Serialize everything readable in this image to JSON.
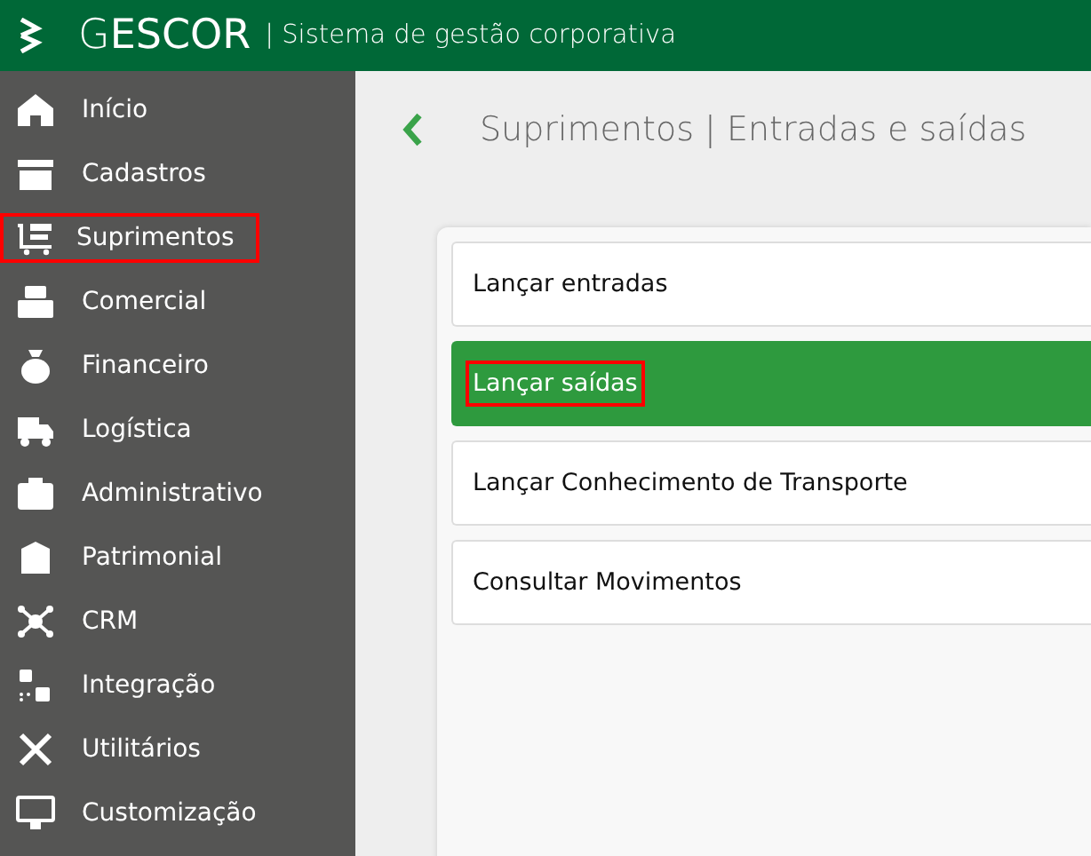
{
  "header": {
    "logo": "G**ESCOR**",
    "subtitle": "| Sistema de gestão corporativa"
  },
  "sidebar": {
    "items": [
      {
        "label": "Início",
        "highlighted": false
      },
      {
        "label": "Cadastros",
        "highlighted": false
      },
      {
        "label": "Suprimentos",
        "highlighted": true
      },
      {
        "label": "Comercial",
        "highlighted": false
      },
      {
        "label": "Financeiro",
        "highlighted": false
      },
      {
        "label": "Logística",
        "highlighted": false
      },
      {
        "label": "Administrativo",
        "highlighted": false
      },
      {
        "label": "Patrimonial",
        "highlighted": false
      },
      {
        "label": "CRM",
        "highlighted": false
      },
      {
        "label": "Integração",
        "highlighted": false
      },
      {
        "label": "Utilitários",
        "highlighted": false
      },
      {
        "label": "Customização",
        "highlighted": false
      }
    ]
  },
  "page": {
    "title": "Suprimentos | Entradas e saídas"
  },
  "options": [
    {
      "label": "Lançar entradas",
      "selected": false,
      "highlighted": false
    },
    {
      "label": "Lançar saídas",
      "selected": true,
      "highlighted": true
    },
    {
      "label": "Lançar Conhecimento de Transporte",
      "selected": false,
      "highlighted": false
    },
    {
      "label": "Consultar Movimentos",
      "selected": false,
      "highlighted": false
    }
  ]
}
